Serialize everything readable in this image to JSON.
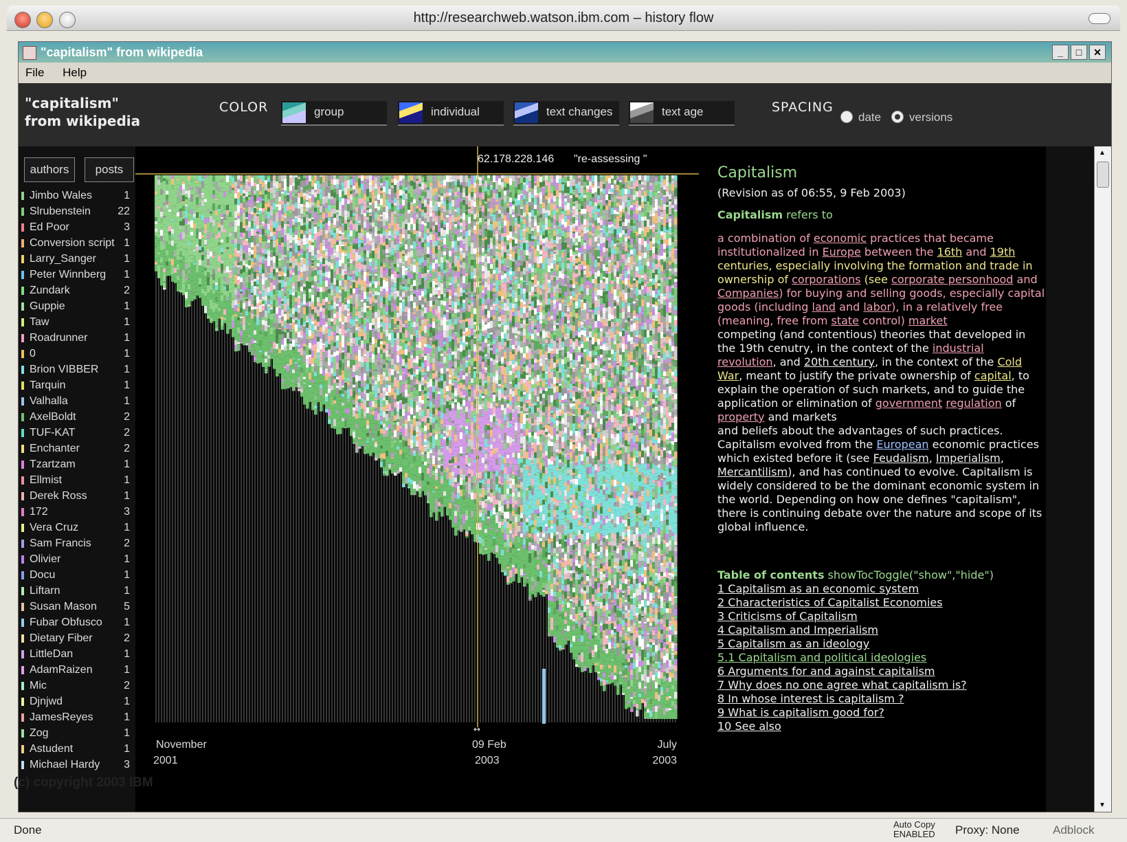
{
  "browser": {
    "title": "http://researchweb.watson.ibm.com – history flow"
  },
  "window": {
    "title": "\"capitalism\" from wikipedia"
  },
  "menu": [
    "File",
    "Help"
  ],
  "controls": {
    "doc_title": "\"capitalism\"\nfrom wikipedia",
    "color_label": "COLOR",
    "color_buttons": [
      {
        "label": "group",
        "swatch": [
          "#2c9c9a",
          "#7fd3c9",
          "#c7c7ff"
        ]
      },
      {
        "label": "individual",
        "swatch": [
          "#3b6cff",
          "#ffe36b",
          "#1a1a88"
        ]
      },
      {
        "label": "text changes",
        "swatch": [
          "#2d58b8",
          "#b9c4ff",
          "#0f2f7f"
        ]
      },
      {
        "label": "text age",
        "swatch": [
          "#ffffff",
          "#9a9a9a",
          "#444444"
        ]
      }
    ],
    "spacing_label": "SPACING",
    "spacing_options": [
      "date",
      "versions"
    ],
    "spacing_selected": "versions"
  },
  "sidebar": {
    "tabs": [
      "authors",
      "posts"
    ],
    "authors": [
      {
        "name": "Jimbo Wales",
        "count": "1",
        "color": "#8fd18f"
      },
      {
        "name": "Slrubenstein",
        "count": "22",
        "color": "#7fd07f"
      },
      {
        "name": "Ed Poor",
        "count": "3",
        "color": "#f08090"
      },
      {
        "name": "Conversion script",
        "count": "1",
        "color": "#f4b070"
      },
      {
        "name": "Larry_Sanger",
        "count": "1",
        "color": "#f0d070"
      },
      {
        "name": "Peter Winnberg",
        "count": "1",
        "color": "#70c0f0"
      },
      {
        "name": "Zundark",
        "count": "2",
        "color": "#80e080"
      },
      {
        "name": "Guppie",
        "count": "1",
        "color": "#a0e0a0"
      },
      {
        "name": "Taw",
        "count": "1",
        "color": "#d0f080"
      },
      {
        "name": "Roadrunner",
        "count": "1",
        "color": "#f0a0c0"
      },
      {
        "name": "0",
        "count": "1",
        "color": "#f0c060"
      },
      {
        "name": "Brion VIBBER",
        "count": "1",
        "color": "#80e0e0"
      },
      {
        "name": "Tarquin",
        "count": "1",
        "color": "#e0e060"
      },
      {
        "name": "Valhalla",
        "count": "1",
        "color": "#a0c0f0"
      },
      {
        "name": "AxelBoldt",
        "count": "2",
        "color": "#70c070"
      },
      {
        "name": "TUF-KAT",
        "count": "2",
        "color": "#60e0c0"
      },
      {
        "name": "Enchanter",
        "count": "2",
        "color": "#f0e080"
      },
      {
        "name": "Tzartzam",
        "count": "1",
        "color": "#e080e0"
      },
      {
        "name": "Ellmist",
        "count": "1",
        "color": "#f090a0"
      },
      {
        "name": "Derek Ross",
        "count": "1",
        "color": "#f0b0b0"
      },
      {
        "name": "172",
        "count": "3",
        "color": "#e080c0"
      },
      {
        "name": "Vera Cruz",
        "count": "1",
        "color": "#f0f080"
      },
      {
        "name": "Sam Francis",
        "count": "2",
        "color": "#a0a0f0"
      },
      {
        "name": "Olivier",
        "count": "1",
        "color": "#c080f0"
      },
      {
        "name": "Docu",
        "count": "1",
        "color": "#80a0f0"
      },
      {
        "name": "Liftarn",
        "count": "1",
        "color": "#b0f0b0"
      },
      {
        "name": "Susan Mason",
        "count": "5",
        "color": "#f0c0a0"
      },
      {
        "name": "Fubar Obfusco",
        "count": "1",
        "color": "#90d0f0"
      },
      {
        "name": "Dietary Fiber",
        "count": "2",
        "color": "#f0e0a0"
      },
      {
        "name": "LittleDan",
        "count": "1",
        "color": "#d0a0f0"
      },
      {
        "name": "AdamRaizen",
        "count": "1",
        "color": "#e0a0f0"
      },
      {
        "name": "Mic",
        "count": "2",
        "color": "#a0f0d0"
      },
      {
        "name": "Djnjwd",
        "count": "1",
        "color": "#f0f0a0"
      },
      {
        "name": "JamesReyes",
        "count": "1",
        "color": "#f0a0a0"
      },
      {
        "name": "Zog",
        "count": "1",
        "color": "#a0e0a0"
      },
      {
        "name": "Astudent",
        "count": "1",
        "color": "#f0d080"
      },
      {
        "name": "Michael Hardy",
        "count": "3",
        "color": "#c0e0f0"
      }
    ]
  },
  "flow": {
    "cursor_ip": "62.178.228.146",
    "cursor_comment": "\"re-assessing \"",
    "cursor_marker": "↔",
    "dates": [
      {
        "line1": "November",
        "line2": "2001"
      },
      {
        "line1": "09 Feb",
        "line2": "2003"
      },
      {
        "line1": "July",
        "line2": "2003"
      }
    ]
  },
  "article": {
    "title": "Capitalism",
    "revision": "(Revision as of 06:55, 9 Feb 2003)",
    "lead_bold": "Capitalism",
    "lead_rest": " refers to",
    "toc_bold": "Table of contents",
    "toc_rest": " showTocToggle(\"show\",\"hide\")",
    "toc": [
      "1  Capitalism as an economic system",
      "2  Characteristics of Capitalist Economies",
      "3  Criticisms of Capitalism",
      "4 Capitalism and Imperialism",
      "5  Capitalism as an ideology",
      "5.1  Capitalism and political ideologies",
      "6  Arguments for and against capitalism",
      "7  Why does no one agree what capitalism is?",
      "8  In whose interest is capitalism ?",
      "9  What is capitalism good for?",
      "10  See also"
    ],
    "colors": {
      "title": "#9bd98f",
      "pink": "#f0a0b0",
      "yellow": "#f0e68c",
      "white": "#f0f0f0"
    }
  },
  "footer": {
    "copyright": "(c) copyright 2003 IBM"
  },
  "status": {
    "left": "Done",
    "autocopy": "Auto Copy",
    "autocopy2": "ENABLED",
    "proxy": "Proxy: None",
    "adblock": "Adblock"
  }
}
